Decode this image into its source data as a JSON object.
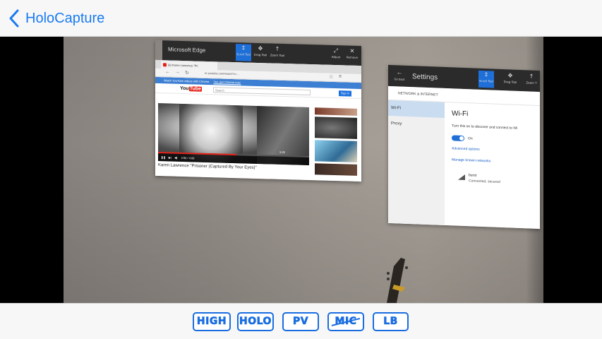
{
  "nav": {
    "back_label": "HoloCapture"
  },
  "edge_window": {
    "title": "Microsoft Edge",
    "tools": [
      "Scroll Tool",
      "Drag Tool",
      "Zoom Tool"
    ],
    "right_tools": [
      "Adjust",
      "Remove"
    ],
    "tab_label": "(6) Karen Lawrence \"Pri",
    "address": "m.youtube.com/watch?v=...",
    "notice": "Watch YouTube videos with Chrome.",
    "notice_link": "Yes, get Chrome now.",
    "yt_logo": "You",
    "yt_logo_tube": "Tube",
    "search_placeholder": "Search",
    "signin_label": "Sign in",
    "video_time": "2:50 / 4:06",
    "video_remaining": "3:45",
    "video_title": "Karen Lawrence \"Prisoner (Captured By Your Eyes)\""
  },
  "settings_window": {
    "title": "Settings",
    "goback_label": "Go back",
    "tools": [
      "Scroll Tool",
      "Drag Tool",
      "Zoom T"
    ],
    "section": "NETWORK & INTERNET",
    "nav_items": [
      "Wi-Fi",
      "Proxy"
    ],
    "wifi_title": "Wi-Fi",
    "wifi_desc": "Turn this on to discover and connect to Wi",
    "toggle_state": "On",
    "link_advanced": "Advanced options",
    "link_manage": "Manage known networks",
    "network_name": "burst",
    "network_status": "Connected, secured"
  },
  "bottom_buttons": [
    {
      "label": "HIGH"
    },
    {
      "label": "HOLO"
    },
    {
      "label": "PV"
    },
    {
      "label": "MIC",
      "struck": true
    },
    {
      "label": "LB"
    }
  ],
  "colors": {
    "accent": "#1a6de0",
    "nav_tint": "#1a7bf2",
    "youtube_red": "#e62117"
  }
}
